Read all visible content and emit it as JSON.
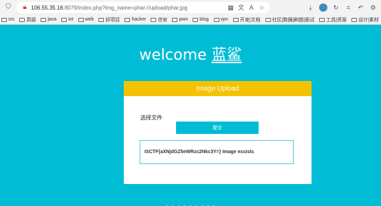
{
  "browser": {
    "url_host": "106.55.35.16",
    "url_path": ":8079/index.php?img_name=phar://upload/phar.jpg",
    "bookmarks": [
      {
        "label": "src"
      },
      {
        "label": "高级"
      },
      {
        "label": "java"
      },
      {
        "label": "iot"
      },
      {
        "label": "web"
      },
      {
        "label": "好项目"
      },
      {
        "label": "hacker"
      },
      {
        "label": "信安"
      },
      {
        "label": "pwn"
      },
      {
        "label": "blog"
      },
      {
        "label": "vpn"
      },
      {
        "label": "开发|文档"
      },
      {
        "label": "社区|数据|刷题|面试"
      },
      {
        "label": "工具|资源"
      },
      {
        "label": "设计|素材"
      },
      {
        "label": "little one"
      }
    ]
  },
  "page": {
    "welcome_prefix": "welcome",
    "welcome_brand": "蓝鲨",
    "card_title": "Image Upload",
    "file_label": "选择文件",
    "submit_label": "提交",
    "result_text": "ISCTF{aXNjdGZ5eWRzc2Nkc3Y=} Image exsists",
    "bottom_text": "· · ·  ·  · · ·  · ·"
  },
  "colors": {
    "background": "#00bcd4",
    "header": "#f5c200",
    "card": "#ffffff"
  }
}
